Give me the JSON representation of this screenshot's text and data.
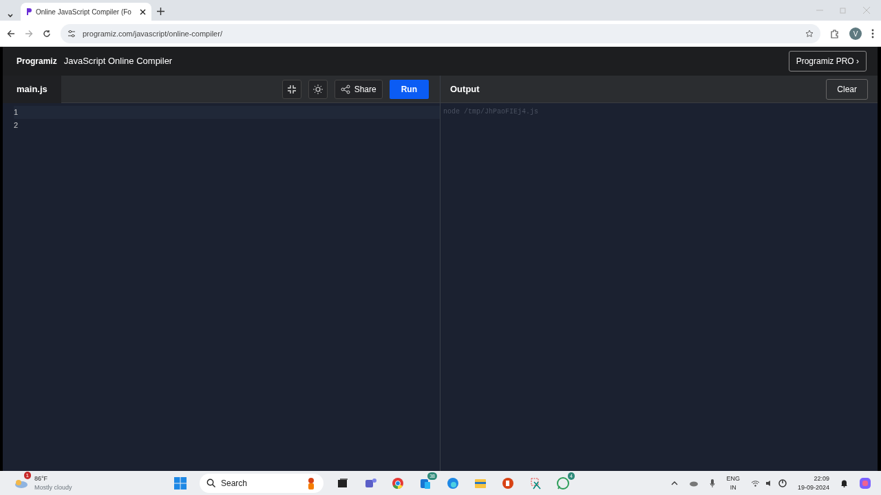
{
  "browser": {
    "tab_title": "Online JavaScript Compiler (Fo",
    "url": "programiz.com/javascript/online-compiler/",
    "profile": "V"
  },
  "header": {
    "logo": "Programiz",
    "title": "JavaScript Online Compiler",
    "pro_button": "Programiz PRO ›"
  },
  "editor": {
    "file_tab": "main.js",
    "share": "Share",
    "run": "Run",
    "line_numbers": [
      "1",
      "2"
    ]
  },
  "output": {
    "title": "Output",
    "clear": "Clear",
    "lines": [
      "node /tmp/JhPaoFIEj4.js"
    ]
  },
  "taskbar": {
    "weather": {
      "temp": "86°F",
      "condition": "Mostly cloudy",
      "badge": "1"
    },
    "search": "Search",
    "badges": {
      "phone_link": "38",
      "whatsapp": "4"
    },
    "language": "ENG",
    "region": "IN",
    "time": "22:09",
    "date": "19-09-2024"
  }
}
